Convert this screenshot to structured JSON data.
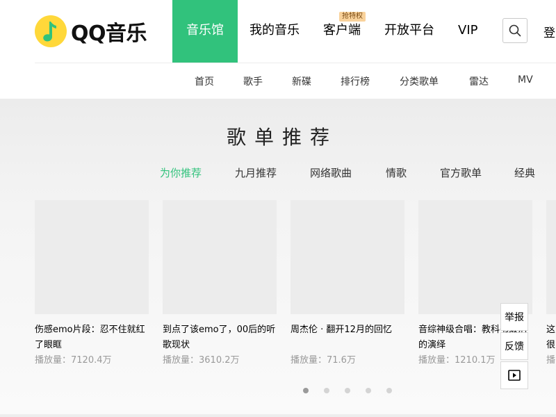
{
  "brand": {
    "name": "QQ音乐",
    "icon": "music-note-logo-icon",
    "accent": "#31c27c",
    "logo_color": "#ffd83a"
  },
  "main_nav": [
    {
      "label": "音乐馆",
      "active": true
    },
    {
      "label": "我的音乐"
    },
    {
      "label": "客户端",
      "badge": "抢特权"
    },
    {
      "label": "开放平台"
    },
    {
      "label": "VIP"
    }
  ],
  "search": {
    "icon": "search-icon"
  },
  "login": {
    "label": "登"
  },
  "sub_nav": [
    "首页",
    "歌手",
    "新碟",
    "排行榜",
    "分类歌单",
    "雷达",
    "MV"
  ],
  "section": {
    "title": "歌单推荐"
  },
  "tabs": [
    {
      "label": "为你推荐",
      "active": true
    },
    {
      "label": "九月推荐"
    },
    {
      "label": "网络歌曲"
    },
    {
      "label": "情歌"
    },
    {
      "label": "官方歌单"
    },
    {
      "label": "经典"
    }
  ],
  "playlists": [
    {
      "title": "伤感emo片段：忍不住就红了眼眶",
      "plays": "播放量：7120.4万"
    },
    {
      "title": "到点了该emo了，00后的听歌现状",
      "plays": "播放量：3610.2万"
    },
    {
      "title": "周杰伦 · 翻开12月的回忆",
      "plays": "播放量：71.6万"
    },
    {
      "title": "音综神级合唱：教科书级别的演绎",
      "plays": "播放量：1210.1万"
    },
    {
      "title": "这很",
      "plays": "播"
    }
  ],
  "carousel": {
    "pages": 5,
    "current": 1
  },
  "side_tools": [
    {
      "label": "举报"
    },
    {
      "label": "反馈"
    },
    {
      "icon": "play-box-icon"
    }
  ]
}
